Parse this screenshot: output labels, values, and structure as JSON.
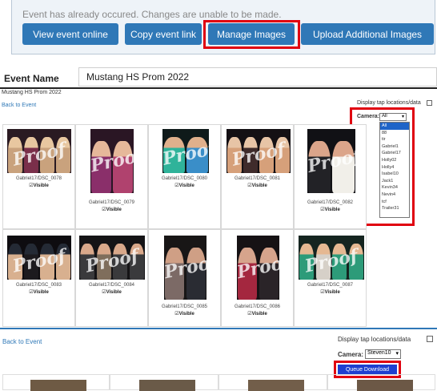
{
  "notice": {
    "text": "Event has already occured. Changes are unable to be made."
  },
  "toolbar": {
    "view_event_online": "View event online",
    "copy_event_link": "Copy event link",
    "manage_images": "Manage Images",
    "upload_additional_images": "Upload Additional Images"
  },
  "event": {
    "label": "Event Name",
    "value": "Mustang HS Prom 2022"
  },
  "gallery": {
    "title": "Mustang HS Prom 2022",
    "back_link": "Back to Event",
    "display_tap_label": "Display tap locations/data",
    "camera_label": "Camera:",
    "camera_selected": "All",
    "camera_options": [
      "All",
      "88",
      "tir",
      "Gabriel1",
      "Gabriel17",
      "Holly02",
      "Holly4",
      "Isabel10",
      "Jack1",
      "Kevin34",
      "Nevin4",
      "tcf",
      "Trailer31"
    ],
    "visible_label": "Visible",
    "images": [
      {
        "caption": "Gabriel17/DSC_0078"
      },
      {
        "caption": "Gabriel17/DSC_0079"
      },
      {
        "caption": "Gabriel17/DSC_0080"
      },
      {
        "caption": "Gabriel17/DSC_0081"
      },
      {
        "caption": "Gabriel17/DSC_0082"
      },
      {
        "caption": "Gabriel17/DSC_0083"
      },
      {
        "caption": "Gabriel17/DSC_0084"
      },
      {
        "caption": "Gabriel17/DSC_0085"
      },
      {
        "caption": "Gabriel17/DSC_0086"
      },
      {
        "caption": "Gabriel17/DSC_0087"
      }
    ],
    "watermark": "Proof"
  },
  "lower": {
    "back_link": "Back to Event",
    "display_tap_label": "Display tap locations/data",
    "camera_label": "Camera:",
    "camera_selected": "Steven10",
    "queue_download": "Queue Download"
  },
  "colors": {
    "primary": "#2f78b7",
    "highlight": "#e00010",
    "queue": "#1e3fd0"
  }
}
